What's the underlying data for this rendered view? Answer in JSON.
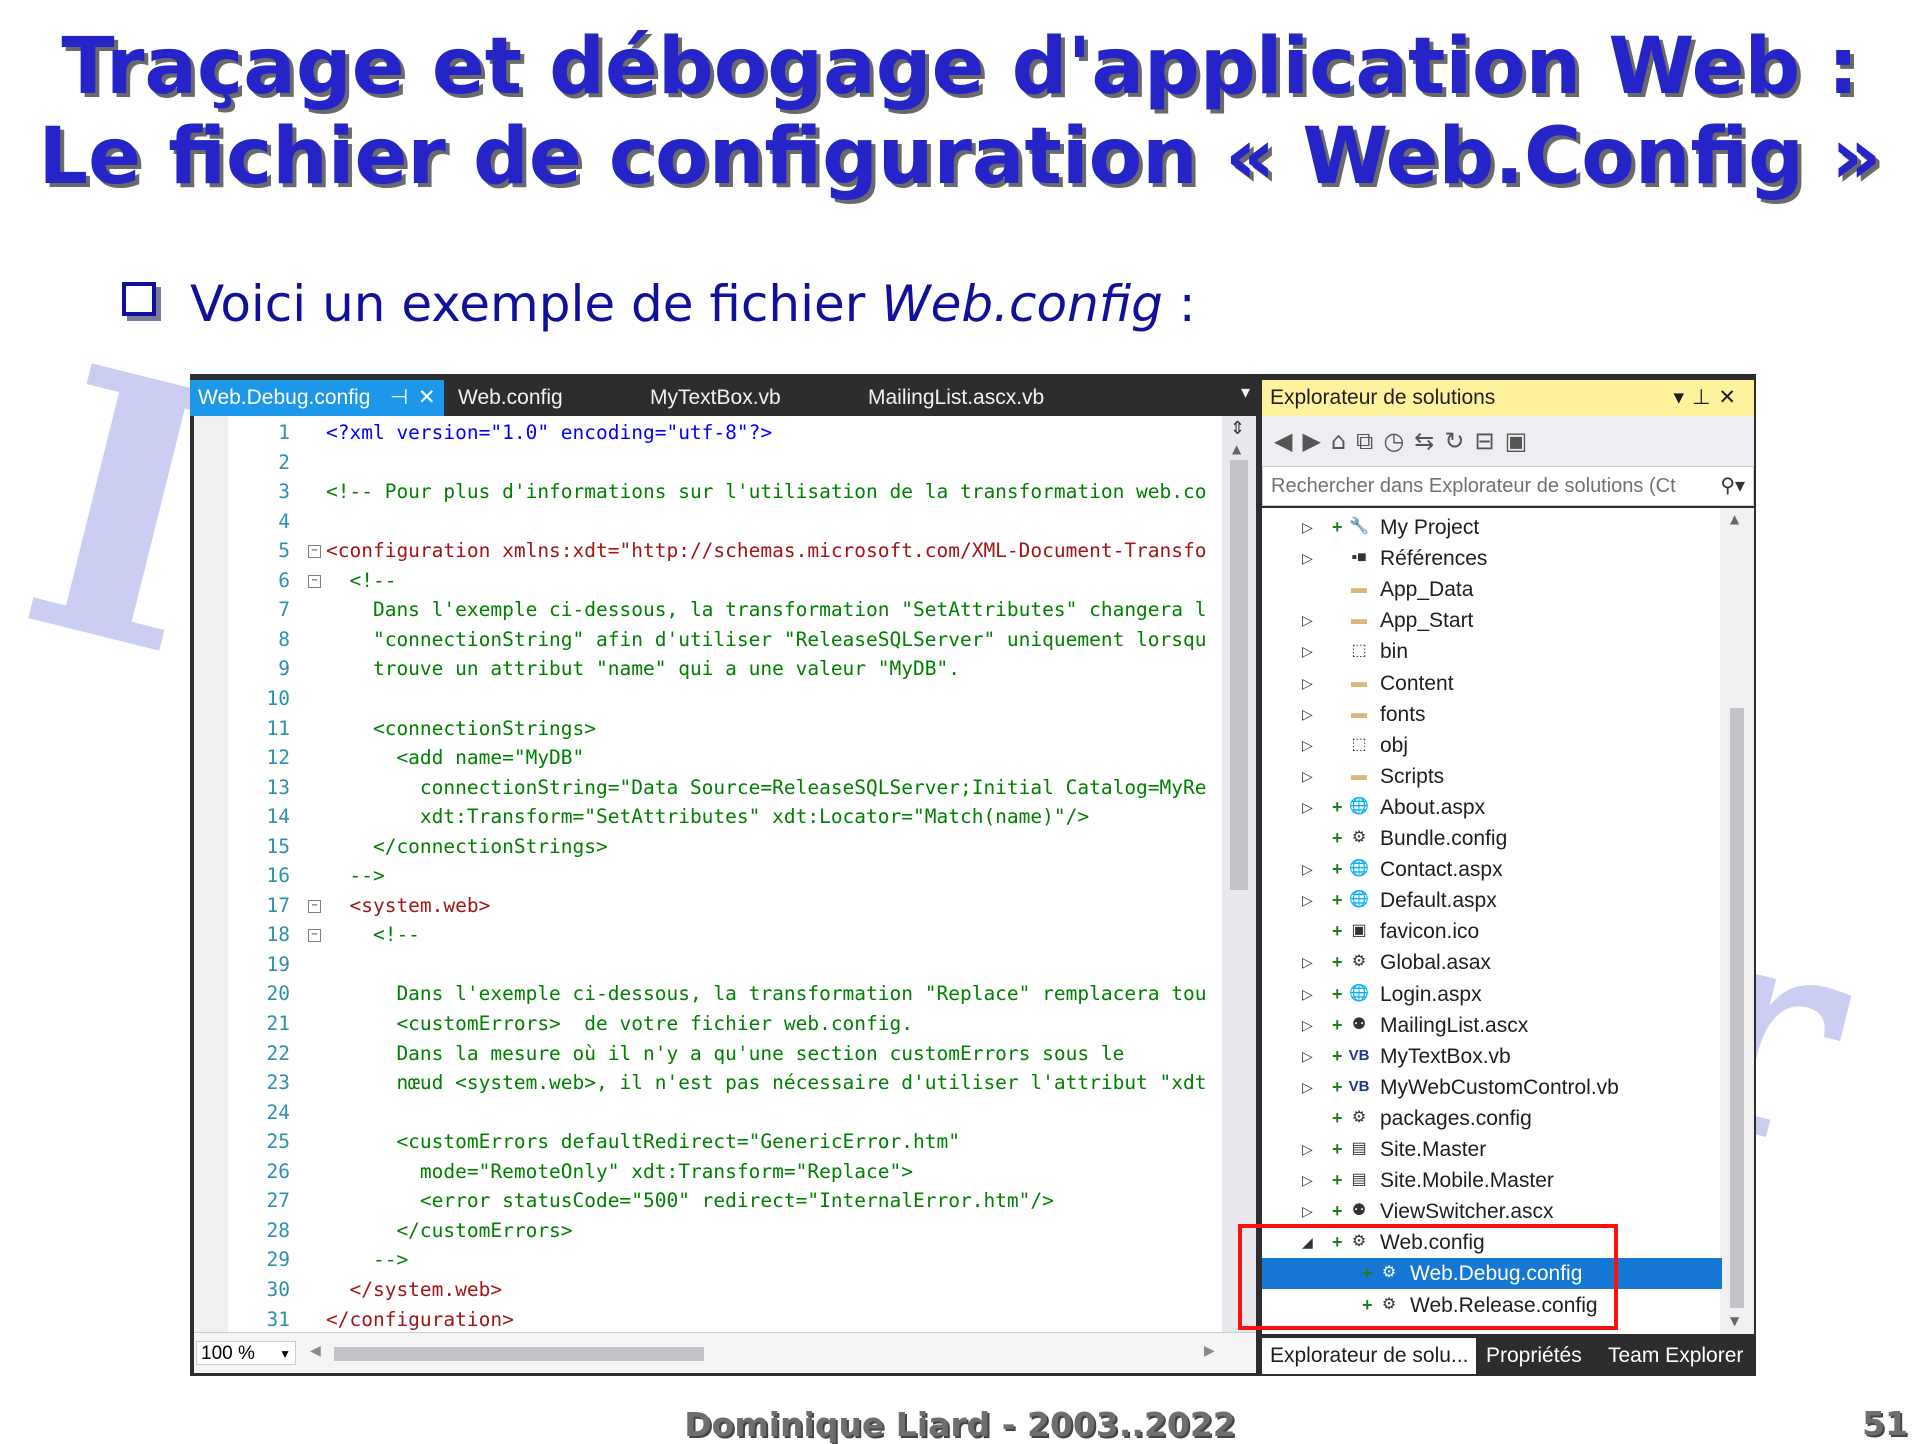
{
  "slide": {
    "title_line1": "Traçage et débogage d'application Web :",
    "title_line2": "Le fichier de configuration «  Web.Config  »",
    "bullet_plain": "Voici un exemple de fichier ",
    "bullet_italic": "Web.config",
    "bullet_end": " :",
    "footer": "Dominique Liard - 2003..2022",
    "page_number": "51"
  },
  "editor": {
    "tabs": [
      "Web.Debug.config",
      "Web.config",
      "MyTextBox.vb",
      "MailingList.ascx.vb"
    ],
    "tab_pin": "⊣",
    "tab_close": "✕",
    "zoom": "100 %",
    "lines": [
      {
        "n": "1",
        "t": "<?xml version=\"1.0\" encoding=\"utf-8\"?>"
      },
      {
        "n": "2",
        "t": ""
      },
      {
        "n": "3",
        "t": "<!-- Pour plus d'informations sur l'utilisation de la transformation web.co"
      },
      {
        "n": "4",
        "t": ""
      },
      {
        "n": "5",
        "t": "<configuration xmlns:xdt=\"http://schemas.microsoft.com/XML-Document-Transfo"
      },
      {
        "n": "6",
        "t": "  <!--"
      },
      {
        "n": "7",
        "t": "    Dans l'exemple ci-dessous, la transformation \"SetAttributes\" changera l"
      },
      {
        "n": "8",
        "t": "    \"connectionString\" afin d'utiliser \"ReleaseSQLServer\" uniquement lorsqu"
      },
      {
        "n": "9",
        "t": "    trouve un attribut \"name\" qui a une valeur \"MyDB\"."
      },
      {
        "n": "10",
        "t": ""
      },
      {
        "n": "11",
        "t": "    <connectionStrings>"
      },
      {
        "n": "12",
        "t": "      <add name=\"MyDB\""
      },
      {
        "n": "13",
        "t": "        connectionString=\"Data Source=ReleaseSQLServer;Initial Catalog=MyRe"
      },
      {
        "n": "14",
        "t": "        xdt:Transform=\"SetAttributes\" xdt:Locator=\"Match(name)\"/>"
      },
      {
        "n": "15",
        "t": "    </connectionStrings>"
      },
      {
        "n": "16",
        "t": "  -->"
      },
      {
        "n": "17",
        "t": "  <system.web>"
      },
      {
        "n": "18",
        "t": "    <!--"
      },
      {
        "n": "19",
        "t": ""
      },
      {
        "n": "20",
        "t": "      Dans l'exemple ci-dessous, la transformation \"Replace\" remplacera tou"
      },
      {
        "n": "21",
        "t": "      <customErrors>  de votre fichier web.config."
      },
      {
        "n": "22",
        "t": "      Dans la mesure où il n'y a qu'une section customErrors sous le"
      },
      {
        "n": "23",
        "t": "      nœud <system.web>, il n'est pas nécessaire d'utiliser l'attribut \"xdt"
      },
      {
        "n": "24",
        "t": ""
      },
      {
        "n": "25",
        "t": "      <customErrors defaultRedirect=\"GenericError.htm\""
      },
      {
        "n": "26",
        "t": "        mode=\"RemoteOnly\" xdt:Transform=\"Replace\">"
      },
      {
        "n": "27",
        "t": "        <error statusCode=\"500\" redirect=\"InternalError.htm\"/>"
      },
      {
        "n": "28",
        "t": "      </customErrors>"
      },
      {
        "n": "29",
        "t": "    -->"
      },
      {
        "n": "30",
        "t": "  </system.web>"
      },
      {
        "n": "31",
        "t": "</configuration>"
      }
    ]
  },
  "solution_explorer": {
    "title": "Explorateur de solutions",
    "search_placeholder": "Rechercher dans Explorateur de solutions (Ct",
    "items": [
      {
        "label": "My Project",
        "icon": "wrench-icon",
        "expander": true
      },
      {
        "label": "Références",
        "icon": "references-icon",
        "expander": true
      },
      {
        "label": "App_Data",
        "icon": "folder-icon",
        "expander": false
      },
      {
        "label": "App_Start",
        "icon": "folder-icon",
        "expander": true
      },
      {
        "label": "bin",
        "icon": "dashed-folder-icon",
        "expander": true
      },
      {
        "label": "Content",
        "icon": "folder-icon",
        "expander": true
      },
      {
        "label": "fonts",
        "icon": "folder-icon",
        "expander": true
      },
      {
        "label": "obj",
        "icon": "dashed-folder-icon",
        "expander": true
      },
      {
        "label": "Scripts",
        "icon": "folder-icon",
        "expander": true
      },
      {
        "label": "About.aspx",
        "icon": "web-page-icon",
        "expander": true
      },
      {
        "label": "Bundle.config",
        "icon": "config-file-icon",
        "expander": false
      },
      {
        "label": "Contact.aspx",
        "icon": "web-page-icon",
        "expander": true
      },
      {
        "label": "Default.aspx",
        "icon": "web-page-icon",
        "expander": true
      },
      {
        "label": "favicon.ico",
        "icon": "image-file-icon",
        "expander": false
      },
      {
        "label": "Global.asax",
        "icon": "global-asax-icon",
        "expander": true
      },
      {
        "label": "Login.aspx",
        "icon": "web-page-icon",
        "expander": true
      },
      {
        "label": "MailingList.ascx",
        "icon": "user-control-icon",
        "expander": true
      },
      {
        "label": "MyTextBox.vb",
        "icon": "vb-file-icon",
        "expander": true
      },
      {
        "label": "MyWebCustomControl.vb",
        "icon": "vb-file-icon",
        "expander": true
      },
      {
        "label": "packages.config",
        "icon": "config-file-icon",
        "expander": false
      },
      {
        "label": "Site.Master",
        "icon": "master-page-icon",
        "expander": true
      },
      {
        "label": "Site.Mobile.Master",
        "icon": "master-page-icon",
        "expander": true
      },
      {
        "label": "ViewSwitcher.ascx",
        "icon": "user-control-icon",
        "expander": true
      },
      {
        "label": "Web.config",
        "icon": "config-file-icon",
        "expander": true
      },
      {
        "label": "Web.Debug.config",
        "icon": "config-file-icon",
        "expander": false
      },
      {
        "label": "Web.Release.config",
        "icon": "config-file-icon",
        "expander": false
      }
    ],
    "bottom_tabs": [
      "Explorateur de solu...",
      "Propriétés",
      "Team Explorer"
    ]
  }
}
